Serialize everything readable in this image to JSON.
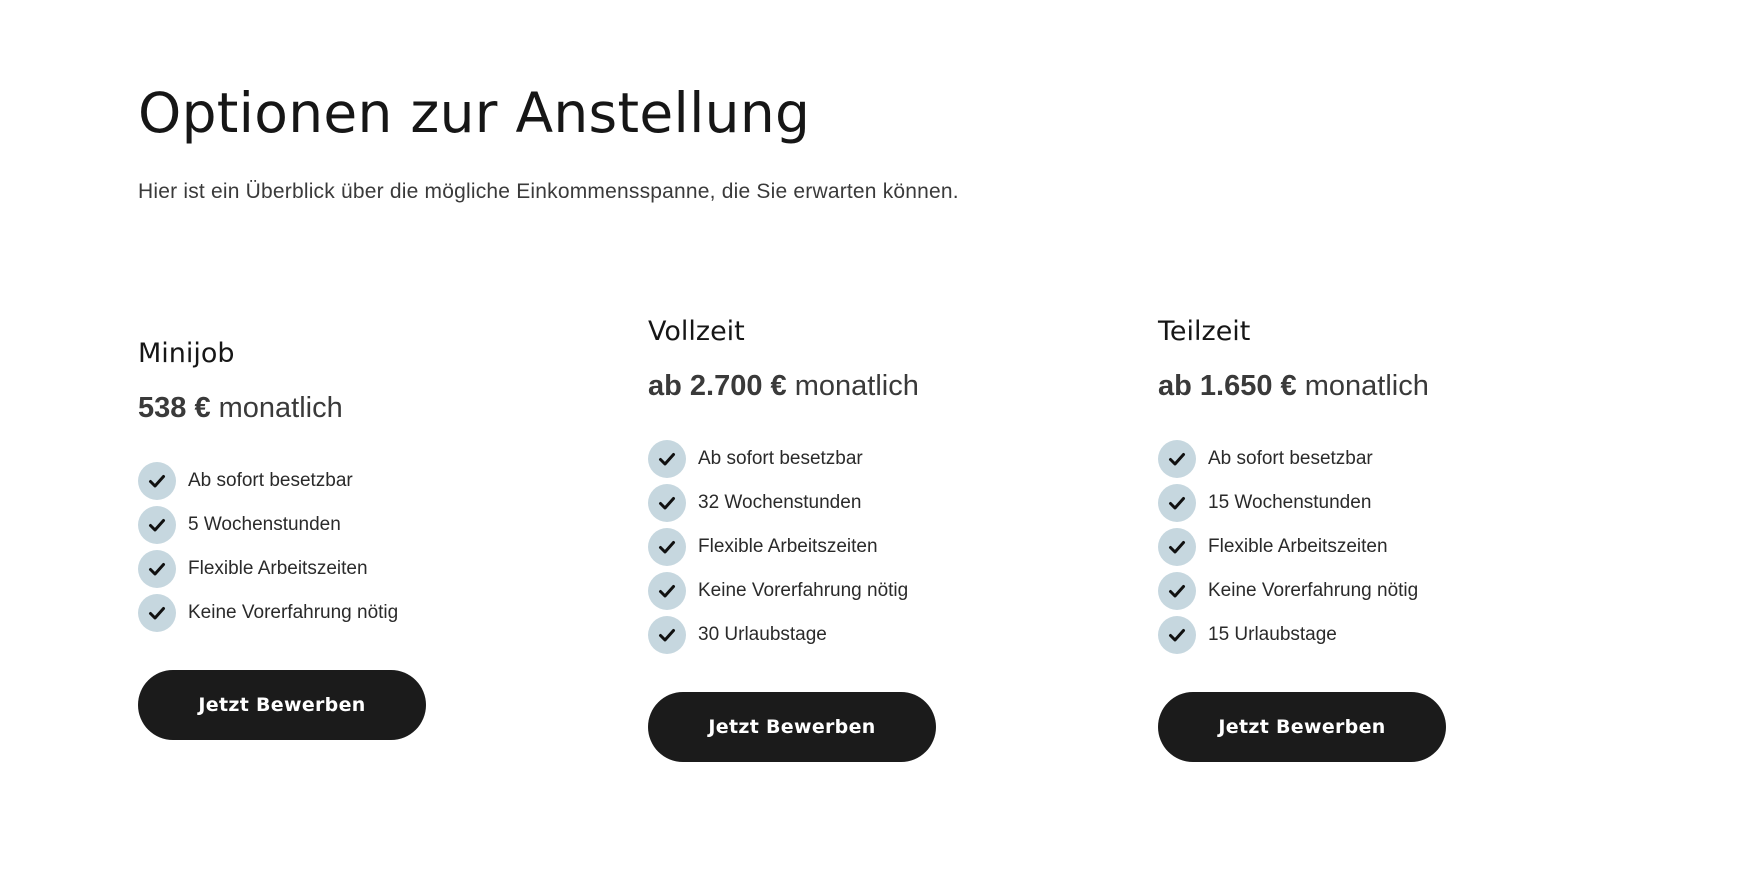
{
  "header": {
    "title": "Optionen zur Anstellung",
    "subtitle": "Hier ist ein Überblick über die mögliche Einkommensspanne, die Sie erwarten können."
  },
  "plans": [
    {
      "name": "Minijob",
      "price_amount": "538 €",
      "price_period": "monatlich",
      "features": [
        "Ab sofort besetzbar",
        "5 Wochenstunden",
        "Flexible Arbeitszeiten",
        "Keine Vorerfahrung nötig"
      ],
      "button_label": "Jetzt Bewerben"
    },
    {
      "name": "Vollzeit",
      "price_amount": "ab 2.700 €",
      "price_period": "monatlich",
      "features": [
        "Ab sofort besetzbar",
        "32 Wochenstunden",
        "Flexible Arbeitszeiten",
        "Keine Vorerfahrung nötig",
        "30 Urlaubstage"
      ],
      "button_label": "Jetzt Bewerben"
    },
    {
      "name": "Teilzeit",
      "price_amount": "ab 1.650 €",
      "price_period": "monatlich",
      "features": [
        "Ab sofort besetzbar",
        "15 Wochenstunden",
        "Flexible Arbeitszeiten",
        "Keine Vorerfahrung nötig",
        "15 Urlaubstage"
      ],
      "button_label": "Jetzt Bewerben"
    }
  ],
  "icons": {
    "feature_icon": "check-icon"
  },
  "colors": {
    "check_circle": "#c6d7df",
    "button_bg": "#1b1b1b",
    "button_text": "#ffffff",
    "heading_text": "#161616",
    "body_text": "#3a3a3a"
  }
}
